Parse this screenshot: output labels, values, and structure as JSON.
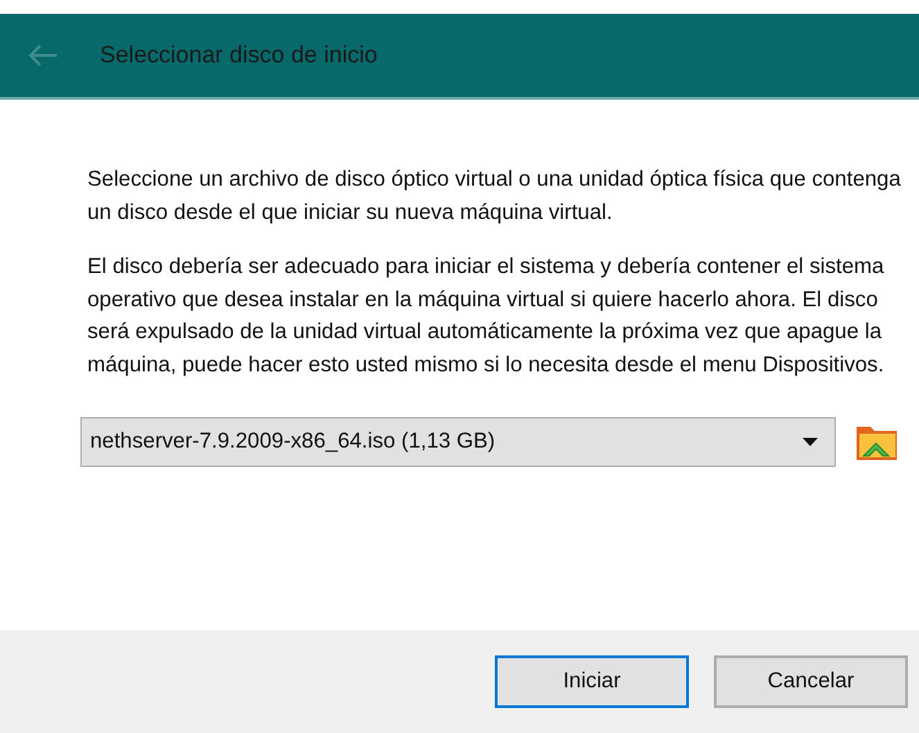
{
  "header": {
    "title": "Seleccionar disco de inicio",
    "back_disabled": true
  },
  "paragraphs": [
    "Seleccione un archivo de disco óptico virtual o una unidad óptica física que contenga un disco desde el que iniciar su nueva máquina virtual.",
    "El disco debería ser adecuado para iniciar el sistema y debería contener el sistema operativo que desea instalar en la máquina virtual si quiere hacerlo ahora. El disco será expulsado de la unidad virtual automáticamente la próxima vez que apague la máquina, puede hacer esto usted mismo si lo necesita desde el menu Dispositivos."
  ],
  "disk_select": {
    "value": "nethserver-7.9.2009-x86_64.iso (1,13 GB)"
  },
  "buttons": [
    {
      "label": "Iniciar",
      "selected": true
    },
    {
      "label": "Cancelar",
      "selected": false
    }
  ]
}
